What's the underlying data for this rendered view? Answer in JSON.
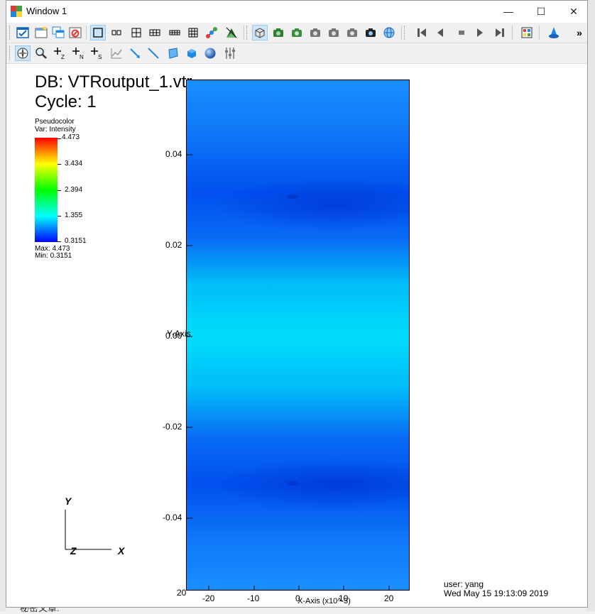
{
  "window": {
    "title": "Window 1"
  },
  "window_controls": {
    "minimize": "—",
    "maximize": "☐",
    "close": "✕"
  },
  "toolbar": {
    "overflow": "»"
  },
  "plot": {
    "db_label": "DB: VTRoutput_1.vtr",
    "cycle_label": "Cycle: 1",
    "legend": {
      "plot_type": "Pseudocolor",
      "var": "Var: Intensity",
      "ticks": [
        "4.473",
        "3.434",
        "2.394",
        "1.355",
        "0.3151"
      ],
      "max": "Max:  4.473",
      "min": "Min:  0.3151",
      "colors": [
        "#ff0000",
        "#ffff00",
        "#00ff00",
        "#00ffff",
        "#0000ff"
      ]
    },
    "y_ticks": [
      "0.04",
      "0.02",
      "0.00",
      "-0.02",
      "-0.04"
    ],
    "y_axis_label": "Y-Axis",
    "x_ticks": [
      "-20",
      "-10",
      "0",
      "10",
      "20"
    ],
    "x_axis_label": "X-Axis (x10^-3)",
    "corner_label": "20",
    "triad": {
      "y": "Y",
      "z": "Z",
      "x": "X"
    },
    "user": "user: yang",
    "date": "Wed May 15 19:13:09 2019"
  },
  "background": {
    "snippet": "秘密文章:"
  }
}
